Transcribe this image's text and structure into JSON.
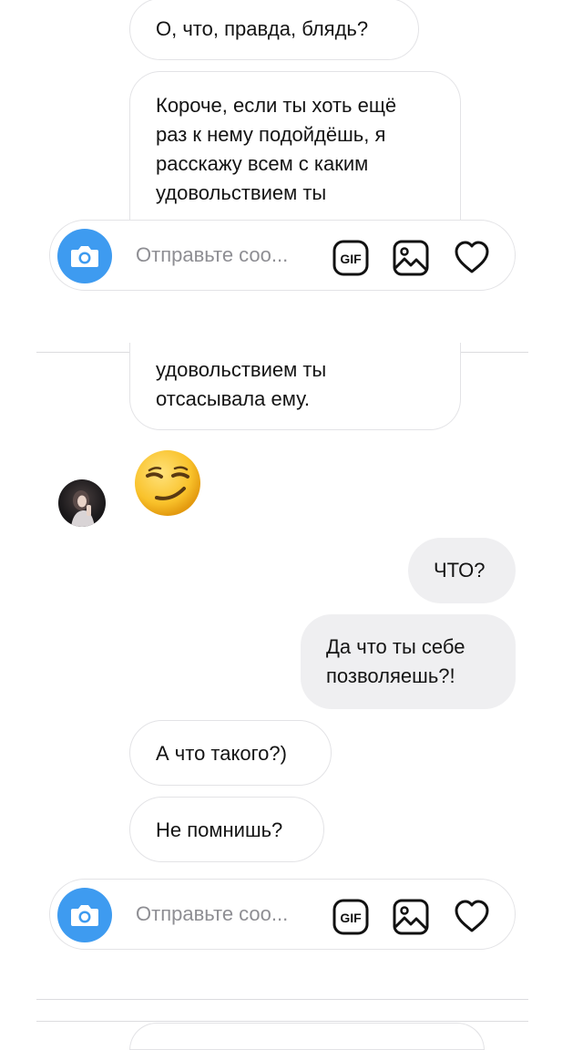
{
  "messages": {
    "m1": "О, что, правда, блядь?",
    "m2_top": "Короче, если ты хоть ещё\nраз к нему подойдёшь, я\nрасскажу  всем с каким\nудовольствием ты",
    "m2_bottom": "удовольствием ты\nотсасывала ему.",
    "m4": "ЧТО?",
    "m5": "Да что ты себе\nпозволяешь?!",
    "m6": "А что такого?)",
    "m7": "Не помнишь?"
  },
  "composer": {
    "placeholder": "Отправьте соо...",
    "gif_label": "GIF"
  },
  "icons": {
    "camera": "camera-icon",
    "gif": "gif-icon",
    "gallery": "gallery-icon",
    "heart": "heart-icon",
    "emoji": "smirk-emoji"
  },
  "colors": {
    "camera_button": "#3e9bf0",
    "outgoing_bubble": "#efeff1",
    "incoming_border": "#e3e3e6",
    "placeholder": "#8e8e93"
  }
}
